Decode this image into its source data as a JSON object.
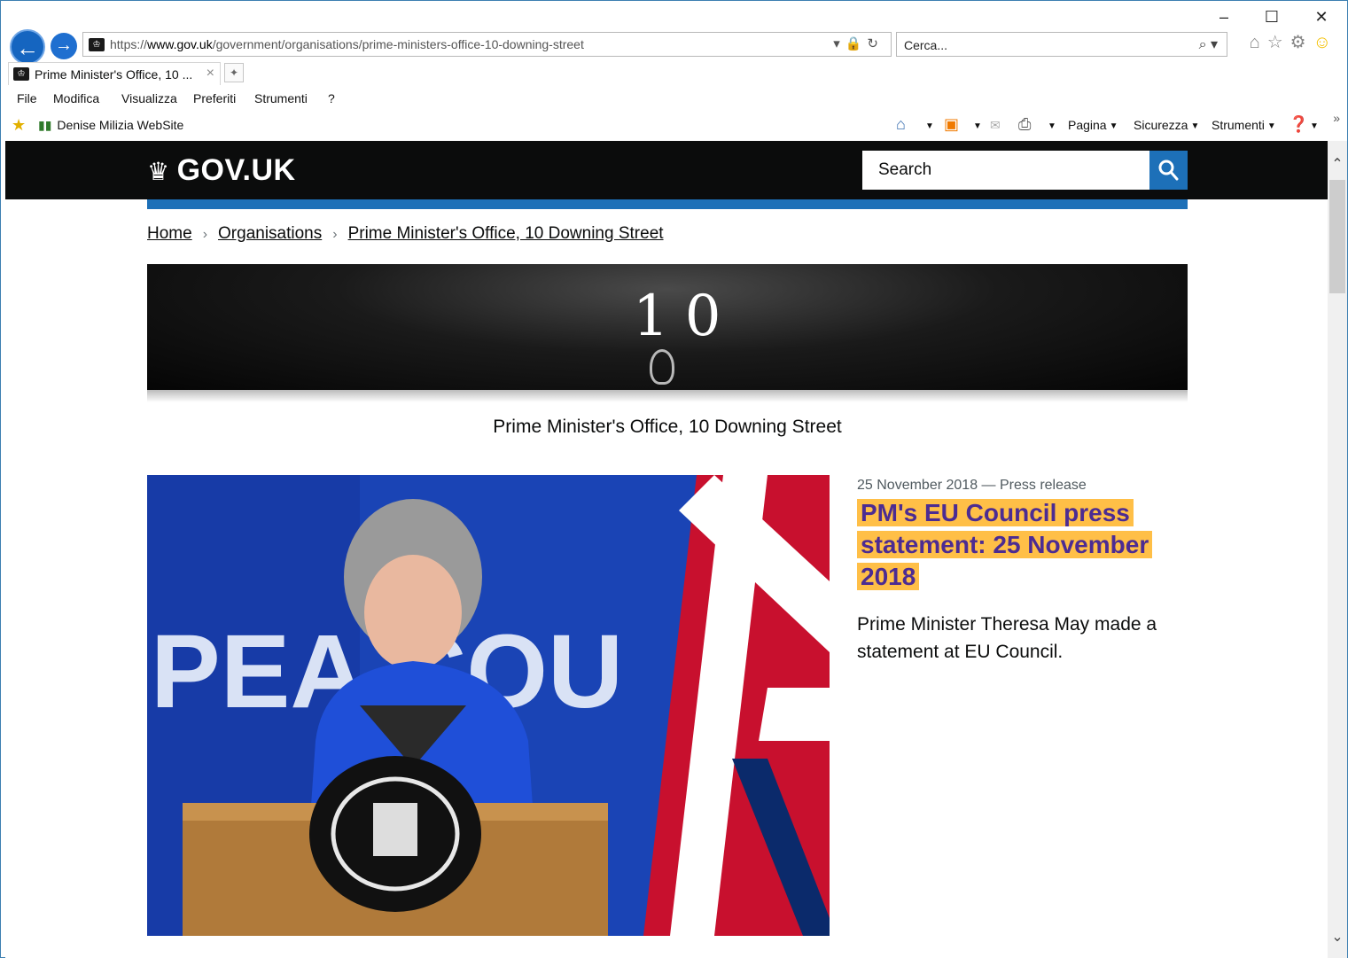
{
  "browser": {
    "address": {
      "scheme": "https://",
      "host": "www.gov.uk",
      "path": "/government/organisations/prime-ministers-office-10-downing-street"
    },
    "search_placeholder": "Cerca...",
    "tab_title": "Prime Minister's Office, 10 ...",
    "menu": [
      "File",
      "Modifica",
      "Visualizza",
      "Preferiti",
      "Strumenti",
      "?"
    ],
    "favorites_link": "Denise Milizia WebSite",
    "commands": {
      "page": "Pagina",
      "safety": "Sicurezza",
      "tools": "Strumenti"
    },
    "colors": {
      "accent": "#1565c0"
    }
  },
  "gov": {
    "logo": "GOV.UK",
    "search_placeholder": "Search",
    "breadcrumbs": [
      "Home",
      "Organisations",
      "Prime Minister's Office, 10 Downing Street"
    ],
    "banner_number": "10",
    "org_name": "Prime Minister's Office, 10 Downing Street",
    "featured": {
      "meta": "25 November 2018 — Press release",
      "title": "PM's EU Council press statement: 25 November 2018",
      "summary": "Prime Minister Theresa May made a statement at EU Council.",
      "image_bg_text": "PEA  COU"
    },
    "colors": {
      "header": "#0b0c0c",
      "blue": "#1d70b8",
      "link_purple": "#4c2c92",
      "highlight": "#ffbf47"
    }
  }
}
